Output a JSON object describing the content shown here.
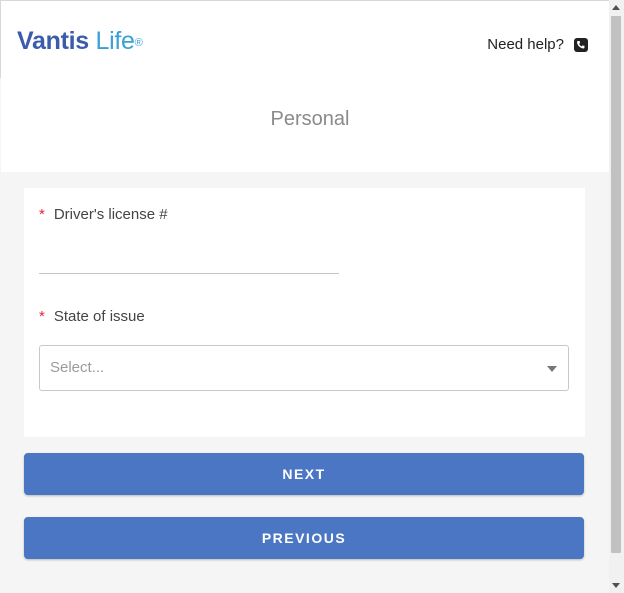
{
  "brand": {
    "name_part1": "Vantis",
    "name_part2": " Life",
    "registered_mark": "®"
  },
  "header": {
    "help_label": "Need help?",
    "help_icon": "phone-icon"
  },
  "page": {
    "title": "Personal"
  },
  "form": {
    "drivers_license": {
      "required_mark": "*",
      "label": "Driver's license #",
      "value": "",
      "placeholder": ""
    },
    "state_of_issue": {
      "required_mark": "*",
      "label": "State of issue",
      "selected": "Select..."
    }
  },
  "actions": {
    "next_label": "NEXT",
    "previous_label": "PREVIOUS"
  },
  "colors": {
    "button": "#4a76c4",
    "brand_dark": "#3b5bab",
    "brand_light": "#3aa0d8",
    "required": "#e0253b"
  }
}
